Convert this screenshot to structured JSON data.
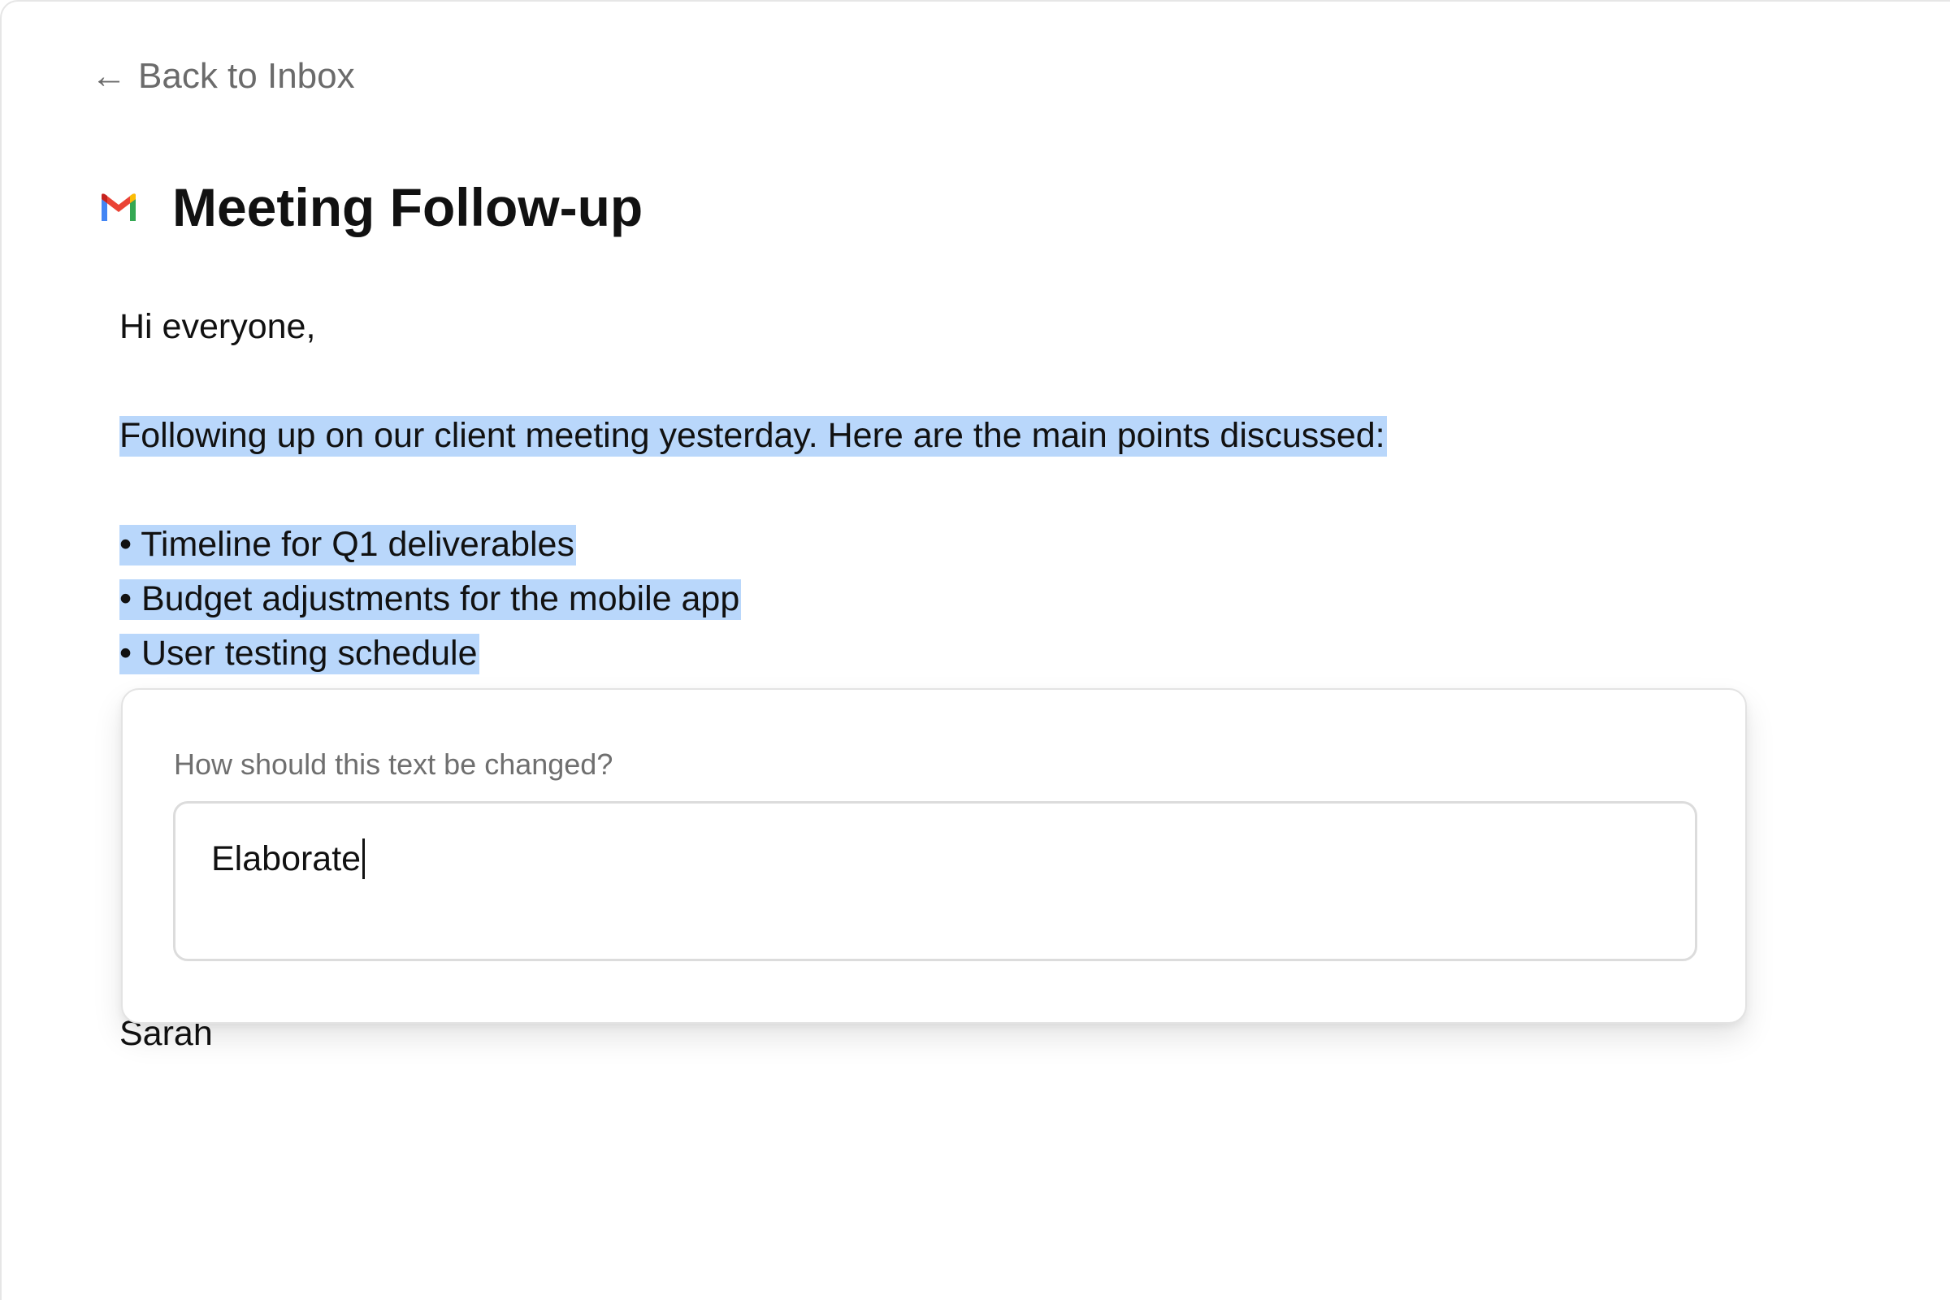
{
  "nav": {
    "back_arrow": "←",
    "back_label": "Back to Inbox"
  },
  "header": {
    "icon": "gmail-icon",
    "title": "Meeting Follow-up"
  },
  "email": {
    "greeting": "Hi everyone,",
    "paragraph": "Following up on our client meeting yesterday. Here are the main points discussed:",
    "bullets": [
      "• Timeline for Q1 deliverables",
      "• Budget adjustments for the mobile app",
      "• User testing schedule"
    ],
    "signature": "Sarah"
  },
  "edit_popover": {
    "label": "How should this text be changed?",
    "input_value": "Elaborate"
  },
  "colors": {
    "selection_highlight": "#b9d7fb",
    "muted_text": "#6b6b6b",
    "text": "#111111",
    "gmail_red": "#ea4335",
    "gmail_blue": "#4285f4",
    "gmail_green": "#34a853",
    "gmail_yellow": "#fbbc04"
  }
}
